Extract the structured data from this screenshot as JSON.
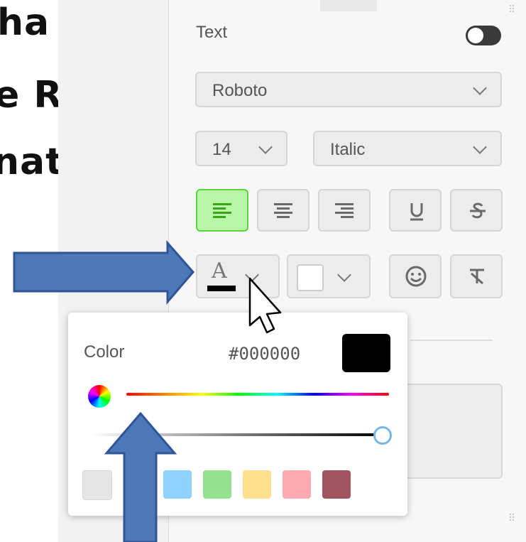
{
  "backdrop": {
    "lines": [
      "ha",
      "e R",
      "nat"
    ]
  },
  "text_panel": {
    "label": "Text",
    "toggle_on": false,
    "font_family": "Roboto",
    "font_size": "14",
    "font_style": "Italic",
    "text_color_glyph": "A"
  },
  "color_popup": {
    "title": "Color",
    "hex_value": "#000000",
    "selected_color": "#000000",
    "palette": [
      "#e5e5e5",
      "#8fd1ff",
      "#94e28f",
      "#ffe08f",
      "#ffaab0",
      "#a05460"
    ]
  },
  "colors": {
    "accent_green": "#b9f5a6",
    "arrow_blue": "#4c78b7"
  }
}
